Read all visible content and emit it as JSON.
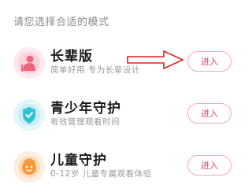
{
  "heading": "请您选择合适的模式",
  "modes": [
    {
      "title": "长辈版",
      "subtitle": "简单好用 专为长辈设计",
      "button": "进入",
      "icon": "elder-person-icon",
      "color": "#f0647e"
    },
    {
      "title": "青少年守护",
      "subtitle": "有效管理观看时间",
      "button": "进入",
      "icon": "teen-shield-icon",
      "color": "#2ec4d6"
    },
    {
      "title": "儿童守护",
      "subtitle": "0-12岁 儿童专属观看体验",
      "button": "进入",
      "icon": "child-face-icon",
      "color": "#f59a3a"
    }
  ],
  "annotation": {
    "color": "#e02020"
  }
}
